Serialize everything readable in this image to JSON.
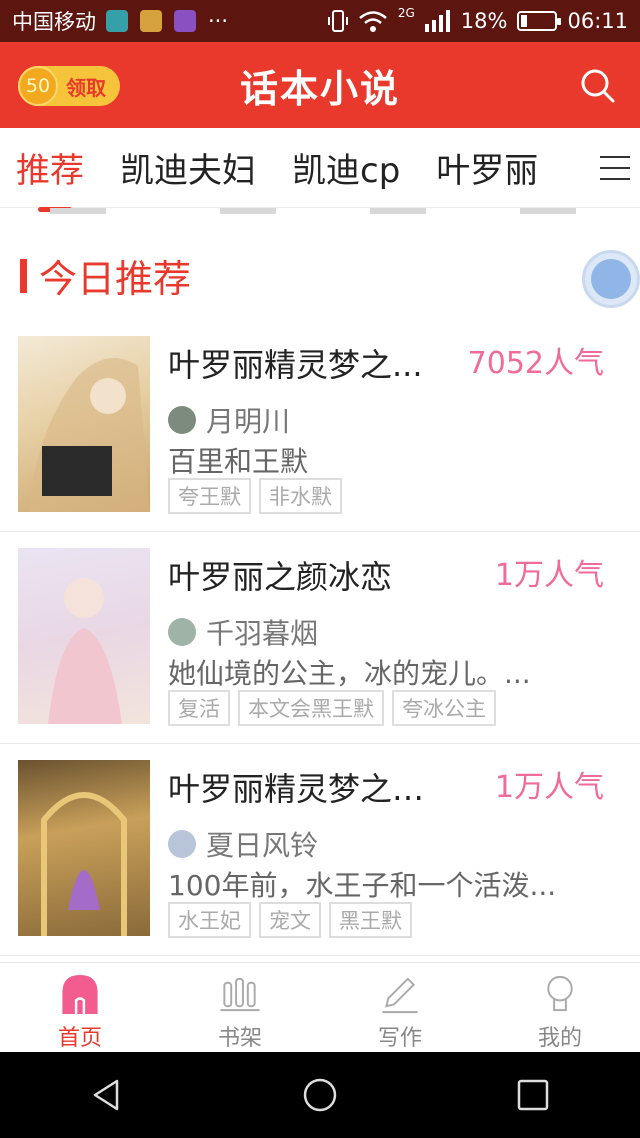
{
  "status_bar": {
    "carrier": "中国移动",
    "dots": "···",
    "network": "2G",
    "battery": "18%",
    "battery_level": 0.18,
    "time": "06:11"
  },
  "header": {
    "coin_value": "50",
    "coin_label": "领取",
    "title": "话本小说"
  },
  "tabs": [
    {
      "label": "推荐",
      "active": true
    },
    {
      "label": "凯迪夫妇",
      "active": false
    },
    {
      "label": "凯迪cp",
      "active": false
    },
    {
      "label": "叶罗丽",
      "active": false
    }
  ],
  "section": {
    "title": "今日推荐"
  },
  "books": [
    {
      "title": "叶罗丽精灵梦之...",
      "popularity": "7052人气",
      "author": "月明川",
      "desc": "百里和王默",
      "tags": [
        "夸王默",
        "非水默"
      ],
      "cover_color": "#e9d7b5"
    },
    {
      "title": "叶罗丽之颜冰恋",
      "popularity": "1万人气",
      "author": "千羽暮烟",
      "desc": "她仙境的公主，冰的宠儿。...",
      "tags": [
        "复活",
        "本文会黑王默",
        "夸冰公主"
      ],
      "cover_color": "#e6d9e8"
    },
    {
      "title": "叶罗丽精灵梦之甜...",
      "popularity": "1万人气",
      "author": "夏日风铃",
      "desc": "100年前，水王子和一个活泼...",
      "tags": [
        "水王妃",
        "宠文",
        "黑王默"
      ],
      "cover_color": "#b08a4e"
    }
  ],
  "bottom_nav": [
    {
      "label": "首页",
      "active": true
    },
    {
      "label": "书架",
      "active": false
    },
    {
      "label": "写作",
      "active": false
    },
    {
      "label": "我的",
      "active": false
    }
  ],
  "colors": {
    "brand": "#e8392c",
    "popularity": "#ef6b9a",
    "status_bar": "#5d1510"
  }
}
